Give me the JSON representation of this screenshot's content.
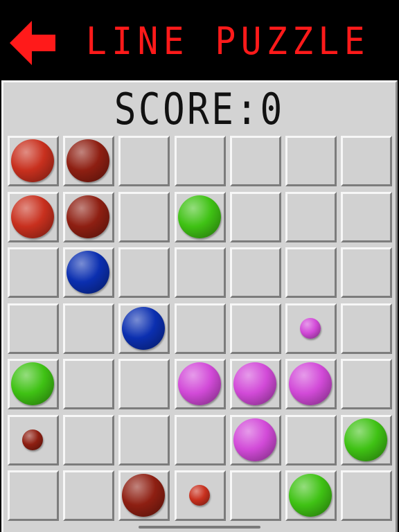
{
  "header": {
    "title": "LINE PUZZLE",
    "back_icon": "arrow-left-icon",
    "accent_color": "#ff1a1a"
  },
  "score": {
    "text": "SCORE:0"
  },
  "board": {
    "rows": 7,
    "cols": 7,
    "colors": {
      "red": "#c8301e",
      "darkred": "#8e1f12",
      "green": "#3fc214",
      "blue": "#0b2fb0",
      "purple": "#d24ad8"
    },
    "balls": [
      {
        "row": 0,
        "col": 0,
        "color": "red",
        "size": "large"
      },
      {
        "row": 0,
        "col": 1,
        "color": "darkred",
        "size": "large"
      },
      {
        "row": 1,
        "col": 0,
        "color": "red",
        "size": "large"
      },
      {
        "row": 1,
        "col": 1,
        "color": "darkred",
        "size": "large"
      },
      {
        "row": 1,
        "col": 3,
        "color": "green",
        "size": "large"
      },
      {
        "row": 2,
        "col": 1,
        "color": "blue",
        "size": "large"
      },
      {
        "row": 3,
        "col": 2,
        "color": "blue",
        "size": "large"
      },
      {
        "row": 3,
        "col": 5,
        "color": "purple",
        "size": "small"
      },
      {
        "row": 4,
        "col": 0,
        "color": "green",
        "size": "large"
      },
      {
        "row": 4,
        "col": 3,
        "color": "purple",
        "size": "large"
      },
      {
        "row": 4,
        "col": 4,
        "color": "purple",
        "size": "large"
      },
      {
        "row": 4,
        "col": 5,
        "color": "purple",
        "size": "large"
      },
      {
        "row": 5,
        "col": 0,
        "color": "darkred",
        "size": "small"
      },
      {
        "row": 5,
        "col": 4,
        "color": "purple",
        "size": "large"
      },
      {
        "row": 5,
        "col": 6,
        "color": "green",
        "size": "large"
      },
      {
        "row": 6,
        "col": 2,
        "color": "darkred",
        "size": "large"
      },
      {
        "row": 6,
        "col": 3,
        "color": "red",
        "size": "small"
      },
      {
        "row": 6,
        "col": 5,
        "color": "green",
        "size": "large"
      }
    ]
  }
}
